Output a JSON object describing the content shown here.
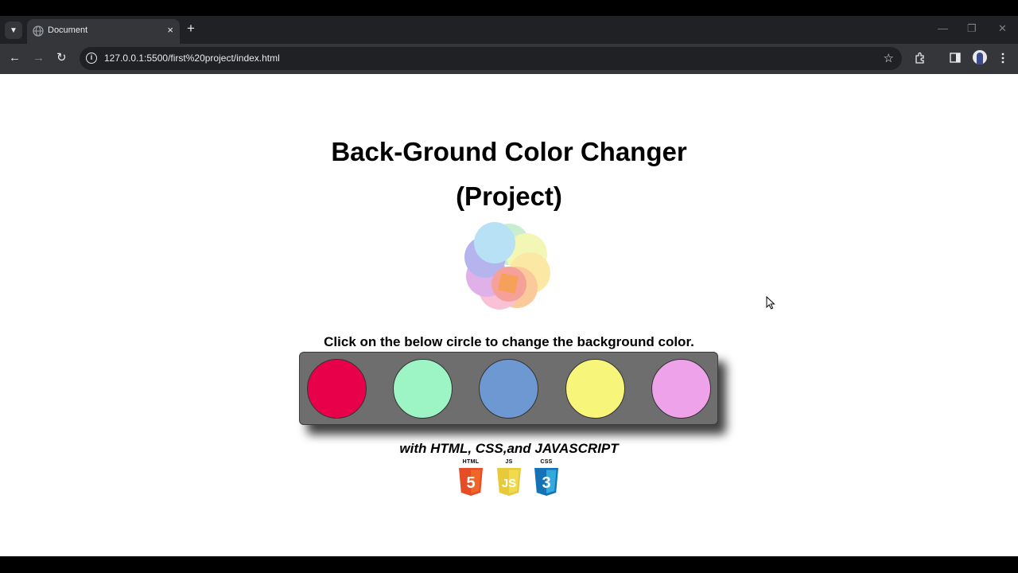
{
  "browser": {
    "tab_title": "Document",
    "tab_close": "×",
    "new_tab": "+",
    "url": "127.0.0.1:5500/first%20project/index.html",
    "icons": [
      "tab-list-icon",
      "globe-icon",
      "close-icon",
      "plus-icon",
      "back-icon",
      "forward-icon",
      "reload-icon",
      "info-icon",
      "star-icon",
      "extensions-icon",
      "side-panel-icon",
      "avatar",
      "menu-icon",
      "minimize-icon",
      "maximize-icon",
      "window-close-icon"
    ]
  },
  "page": {
    "title_line1": "Back-Ground Color Changer",
    "title_line2": "(Project)",
    "instruction": "Click on the below circle to change the background color.",
    "tagline": "with HTML, CSS,and JAVASCRIPT",
    "swatches": [
      {
        "color": "#e8004a"
      },
      {
        "color": "#9df5c6"
      },
      {
        "color": "#6e98d2"
      },
      {
        "color": "#f7f57a"
      },
      {
        "color": "#eea2ea"
      }
    ],
    "logos": [
      {
        "label": "HTML",
        "number": "5",
        "color": "#e44d26"
      },
      {
        "label": "JS",
        "number": "JS",
        "color": "#f0db4f"
      },
      {
        "label": "CSS",
        "number": "3",
        "color": "#2a7ac9"
      }
    ]
  }
}
